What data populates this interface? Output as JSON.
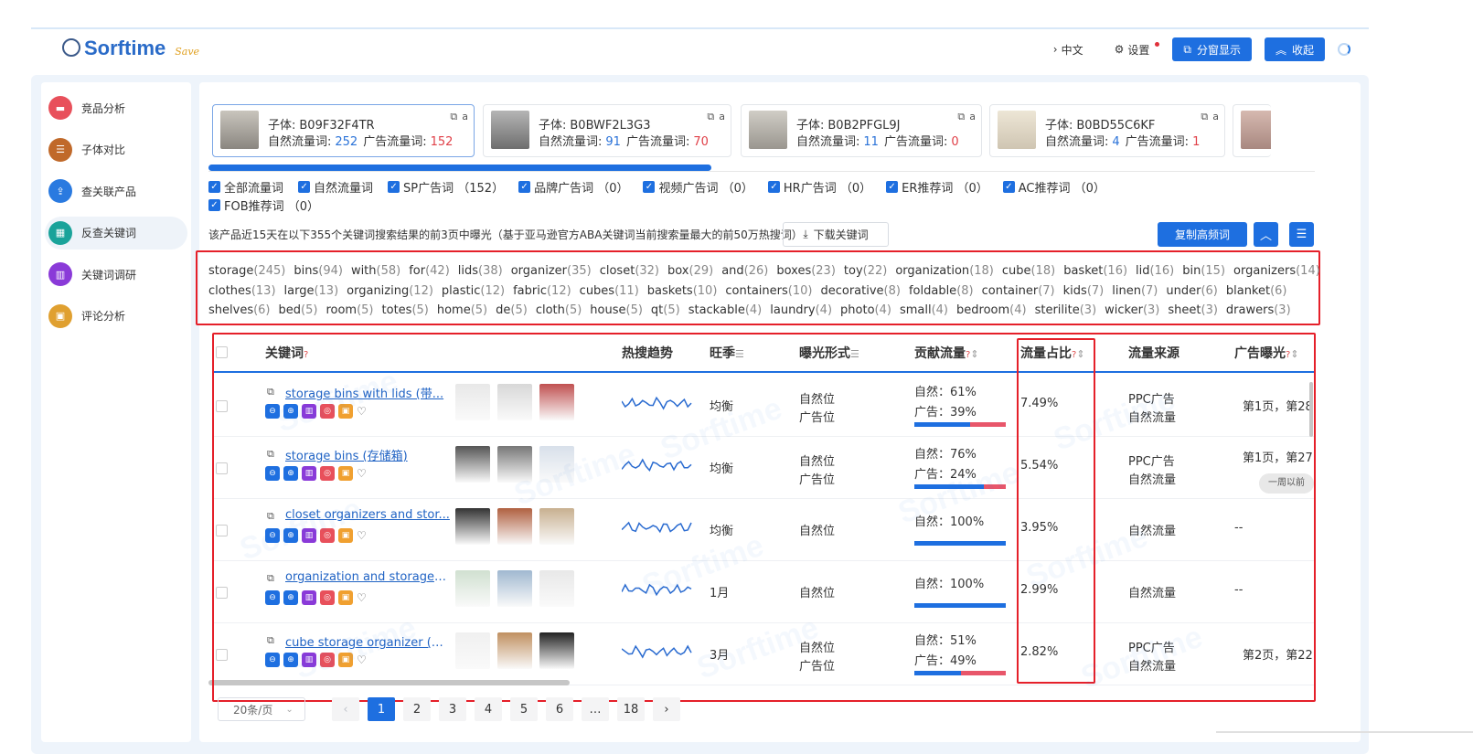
{
  "header": {
    "logo": "Sorftime",
    "logo_sub": "Save",
    "lang": "中文",
    "settings": "设置",
    "split_view": "分窗显示",
    "collapse": "收起"
  },
  "sidebar": {
    "items": [
      {
        "label": "竞品分析",
        "color": "#e8505b",
        "active": false
      },
      {
        "label": "子体对比",
        "color": "#c0692a",
        "active": false
      },
      {
        "label": "查关联产品",
        "color": "#2a7ae0",
        "active": false
      },
      {
        "label": "反查关键词",
        "color": "#1aa39a",
        "active": true
      },
      {
        "label": "关键词调研",
        "color": "#8a3ad8",
        "active": false
      },
      {
        "label": "评论分析",
        "color": "#e0a030",
        "active": false
      }
    ]
  },
  "cards": [
    {
      "child_label": "子体:",
      "asin": "B09F32F4TR",
      "natural_label": "自然流量词:",
      "natural": "252",
      "ad_label": "广告流量词:",
      "ad": "152",
      "selected": true
    },
    {
      "child_label": "子体:",
      "asin": "B0BWF2L3G3",
      "natural_label": "自然流量词:",
      "natural": "91",
      "ad_label": "广告流量词:",
      "ad": "70",
      "selected": false
    },
    {
      "child_label": "子体:",
      "asin": "B0B2PFGL9J",
      "natural_label": "自然流量词:",
      "natural": "11",
      "ad_label": "广告流量词:",
      "ad": "0",
      "selected": false
    },
    {
      "child_label": "子体:",
      "asin": "B0BD55C6KF",
      "natural_label": "自然流量词:",
      "natural": "4",
      "ad_label": "广告流量词:",
      "ad": "1",
      "selected": false
    }
  ],
  "filters": [
    "全部流量词",
    "自然流量词",
    "SP广告词 （152）",
    "品牌广告词 （0）",
    "视频广告词 （0）",
    "HR广告词 （0）",
    "ER推荐词 （0）",
    "AC推荐词 （0）",
    "FOB推荐词 （0）"
  ],
  "info_text": "该产品近15天在以下355个关键词搜索结果的前3页中曝光（基于亚马逊官方ABA关键词当前搜索量最大的前50万热搜词）",
  "download_btn": "下载关键词",
  "copy_btn": "复制高频词",
  "word_rows": [
    [
      [
        "storage",
        "(245)"
      ],
      [
        "bins",
        "(94)"
      ],
      [
        "with",
        "(58)"
      ],
      [
        "for",
        "(42)"
      ],
      [
        "lids",
        "(38)"
      ],
      [
        "organizer",
        "(35)"
      ],
      [
        "closet",
        "(32)"
      ],
      [
        "box",
        "(29)"
      ],
      [
        "and",
        "(26)"
      ],
      [
        "boxes",
        "(23)"
      ],
      [
        "toy",
        "(22)"
      ],
      [
        "organization",
        "(18)"
      ],
      [
        "cube",
        "(18)"
      ],
      [
        "basket",
        "(16)"
      ],
      [
        "lid",
        "(16)"
      ],
      [
        "bin",
        "(15)"
      ],
      [
        "organizers",
        "(14)"
      ]
    ],
    [
      [
        "clothes",
        "(13)"
      ],
      [
        "large",
        "(13)"
      ],
      [
        "organizing",
        "(12)"
      ],
      [
        "plastic",
        "(12)"
      ],
      [
        "fabric",
        "(12)"
      ],
      [
        "cubes",
        "(11)"
      ],
      [
        "baskets",
        "(10)"
      ],
      [
        "containers",
        "(10)"
      ],
      [
        "decorative",
        "(8)"
      ],
      [
        "foldable",
        "(8)"
      ],
      [
        "container",
        "(7)"
      ],
      [
        "kids",
        "(7)"
      ],
      [
        "linen",
        "(7)"
      ],
      [
        "under",
        "(6)"
      ],
      [
        "blanket",
        "(6)"
      ]
    ],
    [
      [
        "shelves",
        "(6)"
      ],
      [
        "bed",
        "(5)"
      ],
      [
        "room",
        "(5)"
      ],
      [
        "totes",
        "(5)"
      ],
      [
        "home",
        "(5)"
      ],
      [
        "de",
        "(5)"
      ],
      [
        "cloth",
        "(5)"
      ],
      [
        "house",
        "(5)"
      ],
      [
        "qt",
        "(5)"
      ],
      [
        "stackable",
        "(4)"
      ],
      [
        "laundry",
        "(4)"
      ],
      [
        "photo",
        "(4)"
      ],
      [
        "small",
        "(4)"
      ],
      [
        "bedroom",
        "(4)"
      ],
      [
        "sterilite",
        "(3)"
      ],
      [
        "wicker",
        "(3)"
      ],
      [
        "sheet",
        "(3)"
      ],
      [
        "drawers",
        "(3)"
      ]
    ]
  ],
  "table": {
    "headers": {
      "keyword": "关键词",
      "trend": "热搜趋势",
      "season": "旺季",
      "exposure": "曝光形式",
      "traffic": "贡献流量",
      "share": "流量占比",
      "source": "流量来源",
      "ad_exposure": "广告曝光"
    },
    "rows": [
      {
        "keyword": "storage bins with lids (带...",
        "season": "均衡",
        "exposure": [
          "自然位",
          "广告位"
        ],
        "natural": "自然：61%",
        "ad": "广告：39%",
        "natural_pct": 61,
        "share": "7.49%",
        "source": [
          "PPC广告",
          "自然流量"
        ],
        "ad_exp": "第1页，第28",
        "pill": ""
      },
      {
        "keyword": "storage bins (存储箱)",
        "season": "均衡",
        "exposure": [
          "自然位",
          "广告位"
        ],
        "natural": "自然：76%",
        "ad": "广告：24%",
        "natural_pct": 76,
        "share": "5.54%",
        "source": [
          "PPC广告",
          "自然流量"
        ],
        "ad_exp": "第1页，第27",
        "pill": "一周以前"
      },
      {
        "keyword": "closet organizers and stor...",
        "season": "均衡",
        "exposure": [
          "自然位"
        ],
        "natural": "自然：100%",
        "ad": "",
        "natural_pct": 100,
        "share": "3.95%",
        "source": [
          "自然流量"
        ],
        "ad_exp": "--",
        "pill": ""
      },
      {
        "keyword": "organization and storage (...",
        "season": "1月",
        "exposure": [
          "自然位"
        ],
        "natural": "自然：100%",
        "ad": "",
        "natural_pct": 100,
        "share": "2.99%",
        "source": [
          "自然流量"
        ],
        "ad_exp": "--",
        "pill": ""
      },
      {
        "keyword": "cube storage organizer (多...",
        "season": "3月",
        "exposure": [
          "自然位",
          "广告位"
        ],
        "natural": "自然：51%",
        "ad": "广告：49%",
        "natural_pct": 51,
        "share": "2.82%",
        "source": [
          "PPC广告",
          "自然流量"
        ],
        "ad_exp": "第2页，第22",
        "pill": ""
      }
    ]
  },
  "pagination": {
    "page_size": "20条/页",
    "pages": [
      "1",
      "2",
      "3",
      "4",
      "5",
      "6",
      "…",
      "18"
    ],
    "current": "1"
  },
  "watermark": "Sorftime"
}
